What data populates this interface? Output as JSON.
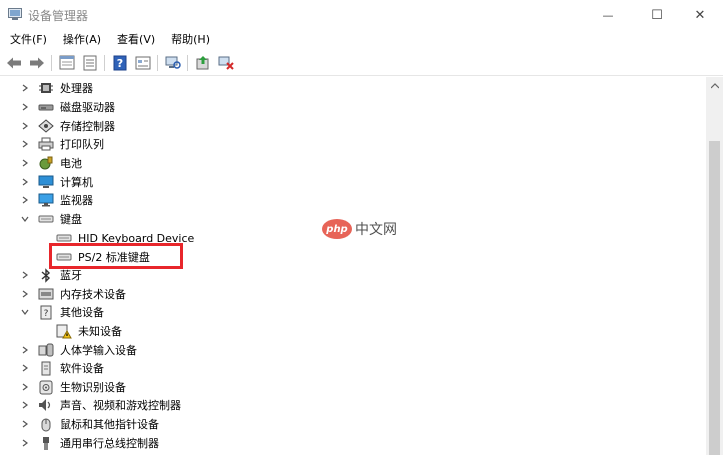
{
  "window": {
    "title": "设备管理器",
    "minimize_glyph": "—",
    "maximize_glyph": "☐",
    "close_glyph": "✕"
  },
  "menu": [
    "文件(F)",
    "操作(A)",
    "查看(V)",
    "帮助(H)"
  ],
  "toolbar": {
    "buttons": [
      "back-arrow-icon",
      "forward-arrow-icon",
      "properties-icon",
      "list-icon",
      "help-icon",
      "view-icon",
      "scan-hardware-icon",
      "update-driver-icon",
      "uninstall-device-icon"
    ]
  },
  "tree": {
    "items": [
      {
        "label": "处理器",
        "icon": "processor-icon",
        "state": "collapsed",
        "level": 0
      },
      {
        "label": "磁盘驱动器",
        "icon": "disk-drive-icon",
        "state": "collapsed",
        "level": 0
      },
      {
        "label": "存储控制器",
        "icon": "storage-controller-icon",
        "state": "collapsed",
        "level": 0
      },
      {
        "label": "打印队列",
        "icon": "printer-icon",
        "state": "collapsed",
        "level": 0
      },
      {
        "label": "电池",
        "icon": "battery-icon",
        "state": "collapsed",
        "level": 0
      },
      {
        "label": "计算机",
        "icon": "computer-icon",
        "state": "collapsed",
        "level": 0
      },
      {
        "label": "监视器",
        "icon": "monitor-icon",
        "state": "collapsed",
        "level": 0
      },
      {
        "label": "键盘",
        "icon": "keyboard-icon",
        "state": "expanded",
        "level": 0
      },
      {
        "label": "HID Keyboard Device",
        "icon": "keyboard-icon",
        "state": "leaf",
        "level": 1
      },
      {
        "label": "PS/2 标准键盘",
        "icon": "keyboard-icon",
        "state": "leaf",
        "level": 1
      },
      {
        "label": "蓝牙",
        "icon": "bluetooth-icon",
        "state": "collapsed",
        "level": 0
      },
      {
        "label": "内存技术设备",
        "icon": "memory-device-icon",
        "state": "collapsed",
        "level": 0
      },
      {
        "label": "其他设备",
        "icon": "other-devices-icon",
        "state": "expanded",
        "level": 0
      },
      {
        "label": "未知设备",
        "icon": "unknown-device-warning-icon",
        "state": "leaf",
        "level": 1
      },
      {
        "label": "人体学输入设备",
        "icon": "hid-device-icon",
        "state": "collapsed",
        "level": 0
      },
      {
        "label": "软件设备",
        "icon": "software-device-icon",
        "state": "collapsed",
        "level": 0
      },
      {
        "label": "生物识别设备",
        "icon": "biometric-device-icon",
        "state": "collapsed",
        "level": 0
      },
      {
        "label": "声音、视频和游戏控制器",
        "icon": "sound-icon",
        "state": "collapsed",
        "level": 0
      },
      {
        "label": "鼠标和其他指针设备",
        "icon": "mouse-icon",
        "state": "collapsed",
        "level": 0
      },
      {
        "label": "通用串行总线控制器",
        "icon": "usb-icon",
        "state": "collapsed",
        "level": 0
      }
    ]
  },
  "watermark": {
    "badge": "php",
    "text": "中文网"
  },
  "colors": {
    "highlight": "#e8262b",
    "accent_blue": "#1e6ec8",
    "watermark": "#e34a3c"
  }
}
